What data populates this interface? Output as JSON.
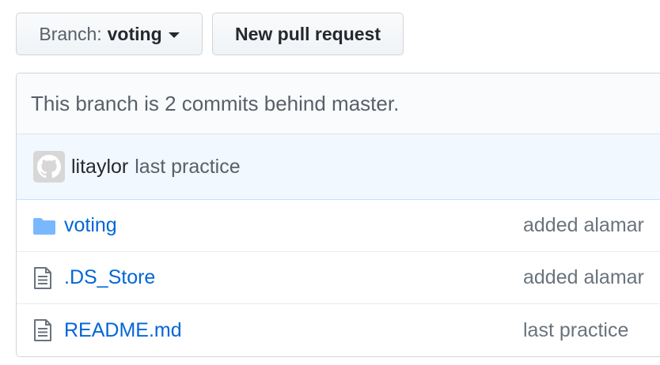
{
  "toolbar": {
    "branch_prefix": "Branch:",
    "branch_name": "voting",
    "new_pr_label": "New pull request"
  },
  "status": {
    "behind_text": "This branch is 2 commits behind master."
  },
  "last_commit": {
    "author": "litaylor",
    "message": "last practice",
    "avatar_icon": "github-octocat-icon"
  },
  "files": [
    {
      "name": "voting",
      "type": "directory",
      "icon": "folder-icon",
      "message": "added alamar"
    },
    {
      "name": ".DS_Store",
      "type": "file",
      "icon": "file-icon",
      "message": "added alamar"
    },
    {
      "name": "README.md",
      "type": "file",
      "icon": "file-icon",
      "message": "last practice"
    }
  ],
  "colors": {
    "link": "#0366d6",
    "folder": "#79b8ff",
    "commit_bar": "#f1f8ff",
    "muted_text": "#586069"
  }
}
